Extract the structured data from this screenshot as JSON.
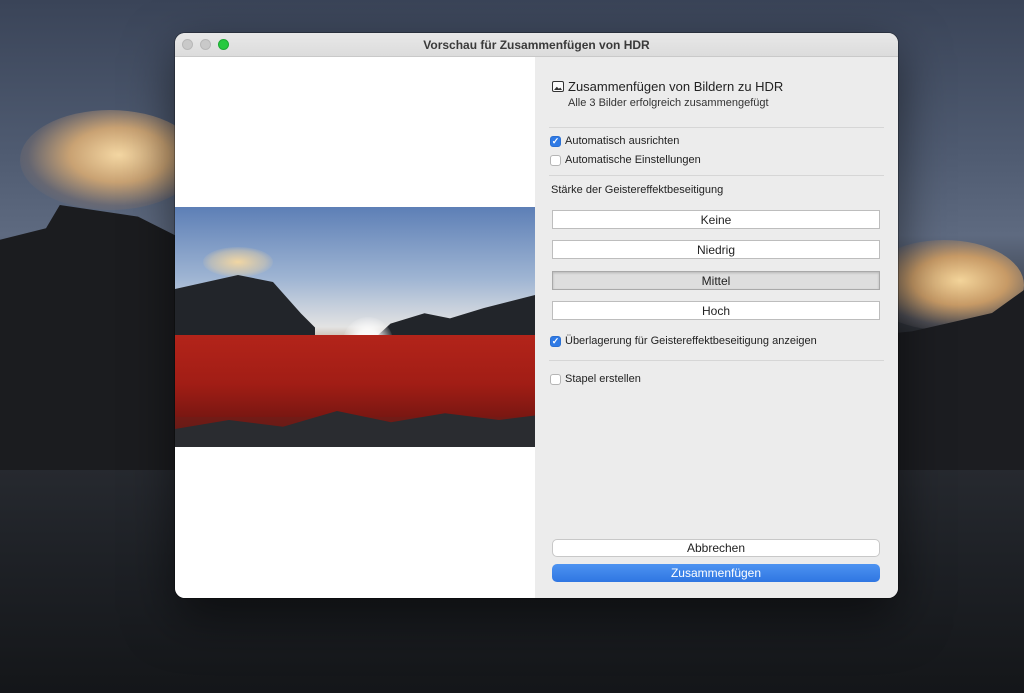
{
  "window": {
    "title": "Vorschau für Zusammenfügen von HDR"
  },
  "header": {
    "icon": "image-icon",
    "title": "Zusammenfügen von Bildern zu HDR",
    "subtitle": "Alle 3 Bilder erfolgreich zusammengefügt"
  },
  "options": {
    "auto_align": {
      "label": "Automatisch ausrichten",
      "checked": true
    },
    "auto_settings": {
      "label": "Automatische Einstellungen",
      "checked": false
    }
  },
  "deghost": {
    "section_label": "Stärke der Geistereffektbeseitigung",
    "levels": [
      "Keine",
      "Niedrig",
      "Mittel",
      "Hoch"
    ],
    "selected": "Mittel",
    "overlay": {
      "label": "Überlagerung für Geistereffektbeseitigung anzeigen",
      "checked": true
    }
  },
  "stack": {
    "label": "Stapel erstellen",
    "checked": false
  },
  "buttons": {
    "cancel": "Abbrechen",
    "merge": "Zusammenfügen"
  },
  "colors": {
    "accent": "#2f76e2",
    "deghost_overlay": "#b3241a"
  }
}
